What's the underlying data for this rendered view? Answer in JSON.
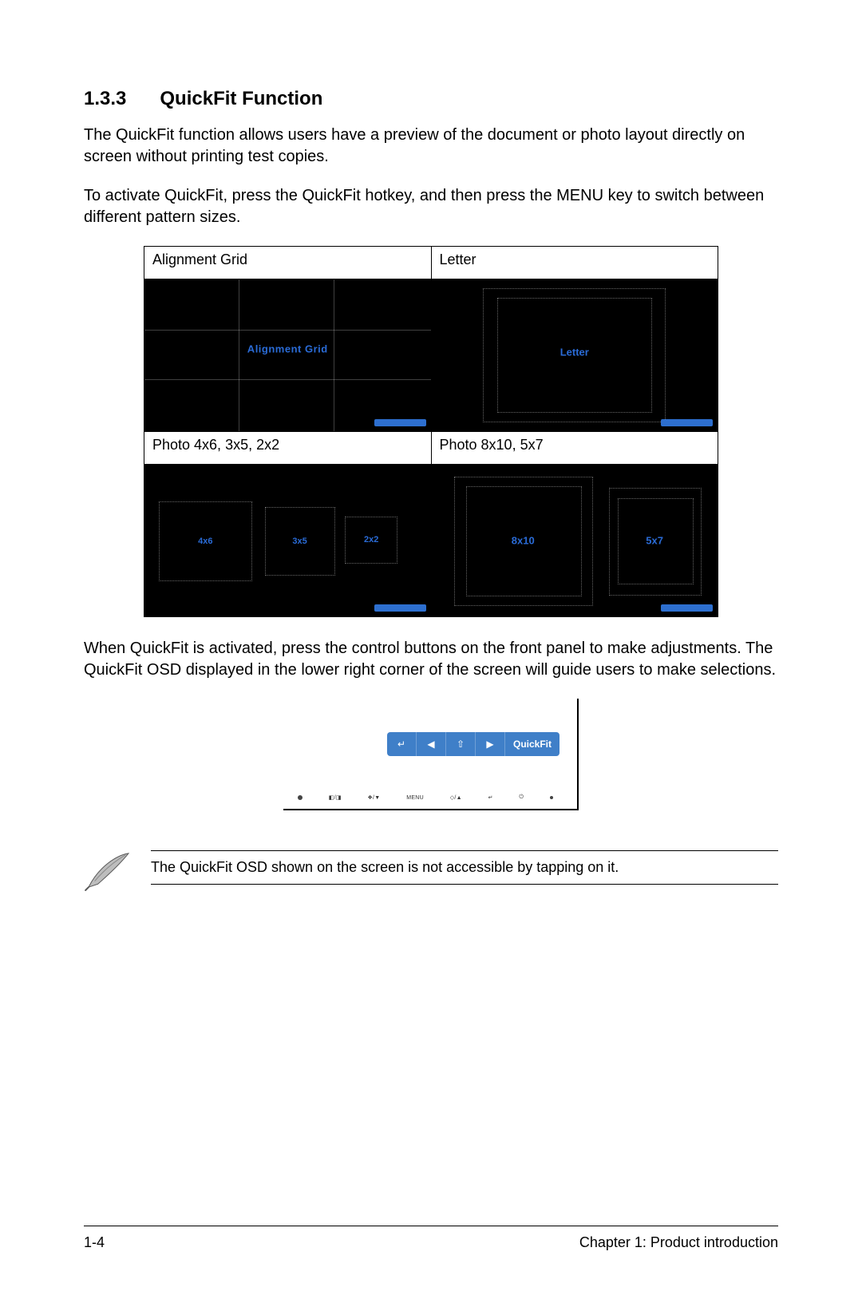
{
  "section": {
    "number": "1.3.3",
    "title": "QuickFit Function"
  },
  "paragraphs": {
    "intro": "The QuickFit function allows users have a preview of the document or photo layout directly on screen without printing test copies.",
    "activate": "To activate QuickFit, press the QuickFit hotkey, and then press the MENU key to switch between different pattern sizes.",
    "adjust": "When QuickFit is activated, press the control buttons on the front panel to make adjustments. The QuickFit OSD displayed in the lower right corner of the screen will guide users to make selections."
  },
  "pattern_table": {
    "cells": {
      "alignment_grid": {
        "label": "Alignment Grid",
        "preview_text": "Alignment Grid"
      },
      "letter": {
        "label": "Letter",
        "preview_text": "Letter"
      },
      "photo_small": {
        "label": "Photo 4x6, 3x5, 2x2",
        "sizes": [
          "4x6",
          "3x5",
          "2x2"
        ]
      },
      "photo_large": {
        "label": "Photo 8x10, 5x7",
        "sizes": [
          "8x10",
          "5x7"
        ]
      }
    }
  },
  "osd": {
    "buttons": [
      "↵",
      "◀",
      "⇧",
      "▶"
    ],
    "label": "QuickFit",
    "panel_button_labels": [
      "",
      "◧/◨",
      "❖/▼",
      "MENU",
      "◇/▲",
      "↵",
      "⏻",
      ""
    ]
  },
  "note": {
    "text": "The QuickFit OSD shown on the screen is not accessible by tapping on it."
  },
  "footer": {
    "page": "1-4",
    "chapter": "Chapter 1: Product introduction"
  }
}
